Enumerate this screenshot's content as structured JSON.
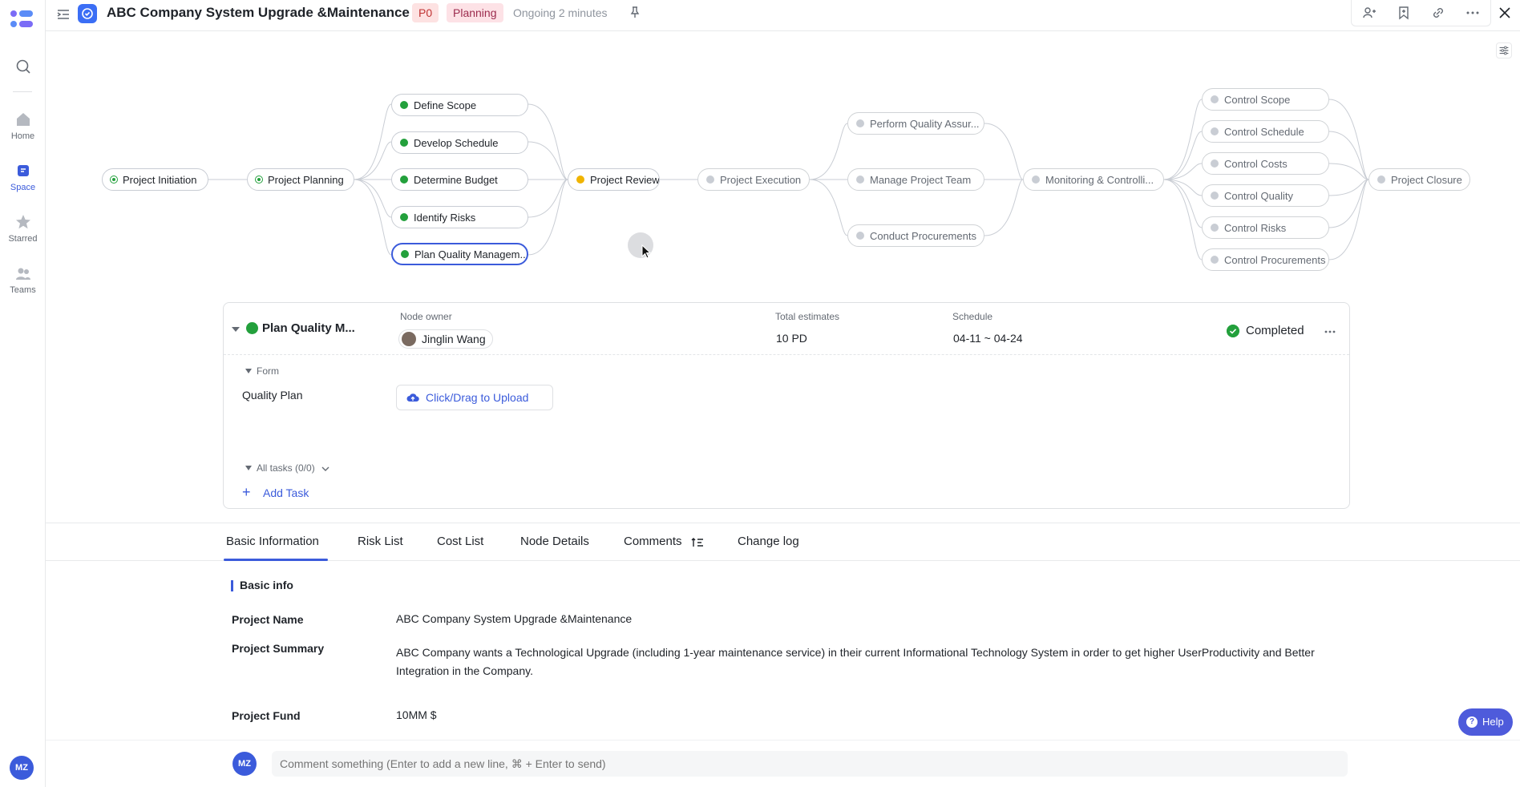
{
  "nav": {
    "items": [
      {
        "label": "Home"
      },
      {
        "label": "Space"
      },
      {
        "label": "Starred"
      },
      {
        "label": "Teams"
      }
    ],
    "user_initials": "MZ"
  },
  "header": {
    "title": "ABC Company System Upgrade &Maintenance",
    "priority": "P0",
    "stage": "Planning",
    "status": "Ongoing 2 minutes"
  },
  "flow": {
    "nodes": [
      {
        "label": "Project Initiation",
        "state": "done"
      },
      {
        "label": "Project Planning",
        "state": "done"
      },
      {
        "label": "Define Scope",
        "state": "done"
      },
      {
        "label": "Develop Schedule",
        "state": "done"
      },
      {
        "label": "Determine Budget",
        "state": "done"
      },
      {
        "label": "Identify Risks",
        "state": "done"
      },
      {
        "label": "Plan Quality Managem...",
        "state": "done"
      },
      {
        "label": "Project Review",
        "state": "in-review"
      },
      {
        "label": "Project Execution",
        "state": "todo"
      },
      {
        "label": "Perform Quality Assur...",
        "state": "todo"
      },
      {
        "label": "Manage Project Team",
        "state": "todo"
      },
      {
        "label": "Conduct Procurements",
        "state": "todo"
      },
      {
        "label": "Monitoring & Controlli...",
        "state": "todo"
      },
      {
        "label": "Control Scope",
        "state": "todo"
      },
      {
        "label": "Control Schedule",
        "state": "todo"
      },
      {
        "label": "Control Costs",
        "state": "todo"
      },
      {
        "label": "Control Quality",
        "state": "todo"
      },
      {
        "label": "Control Risks",
        "state": "todo"
      },
      {
        "label": "Control Procurements",
        "state": "todo"
      },
      {
        "label": "Project Closure",
        "state": "todo"
      }
    ]
  },
  "detail": {
    "node_name": "Plan Quality M...",
    "owner_label": "Node owner",
    "owner": "Jinglin Wang",
    "estimates_label": "Total estimates",
    "estimates": "10 PD",
    "schedule_label": "Schedule",
    "schedule": "04-11 ~ 04-24",
    "status": "Completed",
    "form_title": "Form",
    "field_label": "Quality Plan",
    "upload_label": "Click/Drag to Upload",
    "tasks_label": "All tasks (0/0)",
    "add_task": "Add Task"
  },
  "tabs": [
    {
      "label": "Basic Information",
      "active": true
    },
    {
      "label": "Risk List"
    },
    {
      "label": "Cost List"
    },
    {
      "label": "Node Details"
    },
    {
      "label": "Comments"
    },
    {
      "label": "Change log"
    }
  ],
  "basic_info": {
    "title": "Basic info",
    "fields": [
      {
        "label": "Project Name",
        "value": "ABC Company System Upgrade &Maintenance"
      },
      {
        "label": "Project Summary",
        "value": "ABC Company wants a Technological Upgrade (including 1-year maintenance service) in their current Informational Technology System in order to get higher UserProductivity and Better Integration in the Company."
      },
      {
        "label": "Project Fund",
        "value": "10MM $"
      }
    ]
  },
  "comment": {
    "placeholder": "Comment something (Enter to add a new line, ⌘ + Enter to send)",
    "user_initials": "MZ"
  },
  "help_label": "Help",
  "colors": {
    "accent": "#3b5bdb",
    "done": "#23a03c",
    "review": "#f0b400"
  }
}
